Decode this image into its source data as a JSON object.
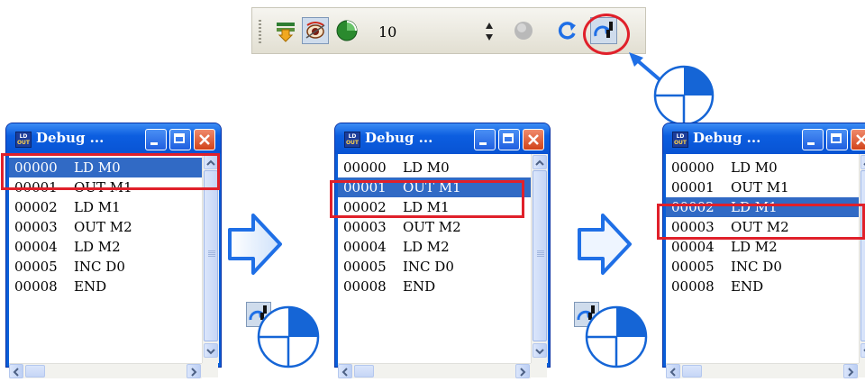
{
  "toolbar": {
    "buttons": [
      {
        "name": "run-to-cursor",
        "icon": "run-cursor-icon"
      },
      {
        "name": "watch-mode",
        "icon": "watch-eye-icon",
        "pressed": true
      },
      {
        "name": "step-over-cycle",
        "icon": "cycle-icon"
      },
      {
        "name": "stop-debug",
        "icon": "grey-circle-icon"
      },
      {
        "name": "refresh",
        "icon": "refresh-icon"
      },
      {
        "name": "single-step",
        "icon": "single-step-icon",
        "highlighted": true
      }
    ],
    "count_value": "10"
  },
  "windows": [
    {
      "title": "Debug ...",
      "icon_text": [
        "LD",
        "OUT"
      ],
      "selected_index": 0,
      "rows": [
        {
          "addr": "00000",
          "instr": "LD M0"
        },
        {
          "addr": "00001",
          "instr": "OUT M1"
        },
        {
          "addr": "00002",
          "instr": "LD M1"
        },
        {
          "addr": "00003",
          "instr": "OUT M2"
        },
        {
          "addr": "00004",
          "instr": "LD M2"
        },
        {
          "addr": "00005",
          "instr": "INC D0"
        },
        {
          "addr": "00008",
          "instr": "END"
        }
      ]
    },
    {
      "title": "Debug ...",
      "icon_text": [
        "LD",
        "OUT"
      ],
      "selected_index": 1,
      "rows": [
        {
          "addr": "00000",
          "instr": "LD M0"
        },
        {
          "addr": "00001",
          "instr": "OUT M1"
        },
        {
          "addr": "00002",
          "instr": "LD M1"
        },
        {
          "addr": "00003",
          "instr": "OUT M2"
        },
        {
          "addr": "00004",
          "instr": "LD M2"
        },
        {
          "addr": "00005",
          "instr": "INC D0"
        },
        {
          "addr": "00008",
          "instr": "END"
        }
      ]
    },
    {
      "title": "Debug ...",
      "icon_text": [
        "LD",
        "OUT"
      ],
      "selected_index": 2,
      "rows": [
        {
          "addr": "00000",
          "instr": "LD M0"
        },
        {
          "addr": "00001",
          "instr": "OUT M1"
        },
        {
          "addr": "00002",
          "instr": "LD M1"
        },
        {
          "addr": "00003",
          "instr": "OUT M2"
        },
        {
          "addr": "00004",
          "instr": "LD M2"
        },
        {
          "addr": "00005",
          "instr": "INC D0"
        },
        {
          "addr": "00008",
          "instr": "END"
        }
      ]
    }
  ],
  "colors": {
    "highlight_red": "#e0202a",
    "selection_blue": "#316ac5",
    "arrow_blue": "#1f6fe6",
    "pie_blue": "#1565d6"
  }
}
